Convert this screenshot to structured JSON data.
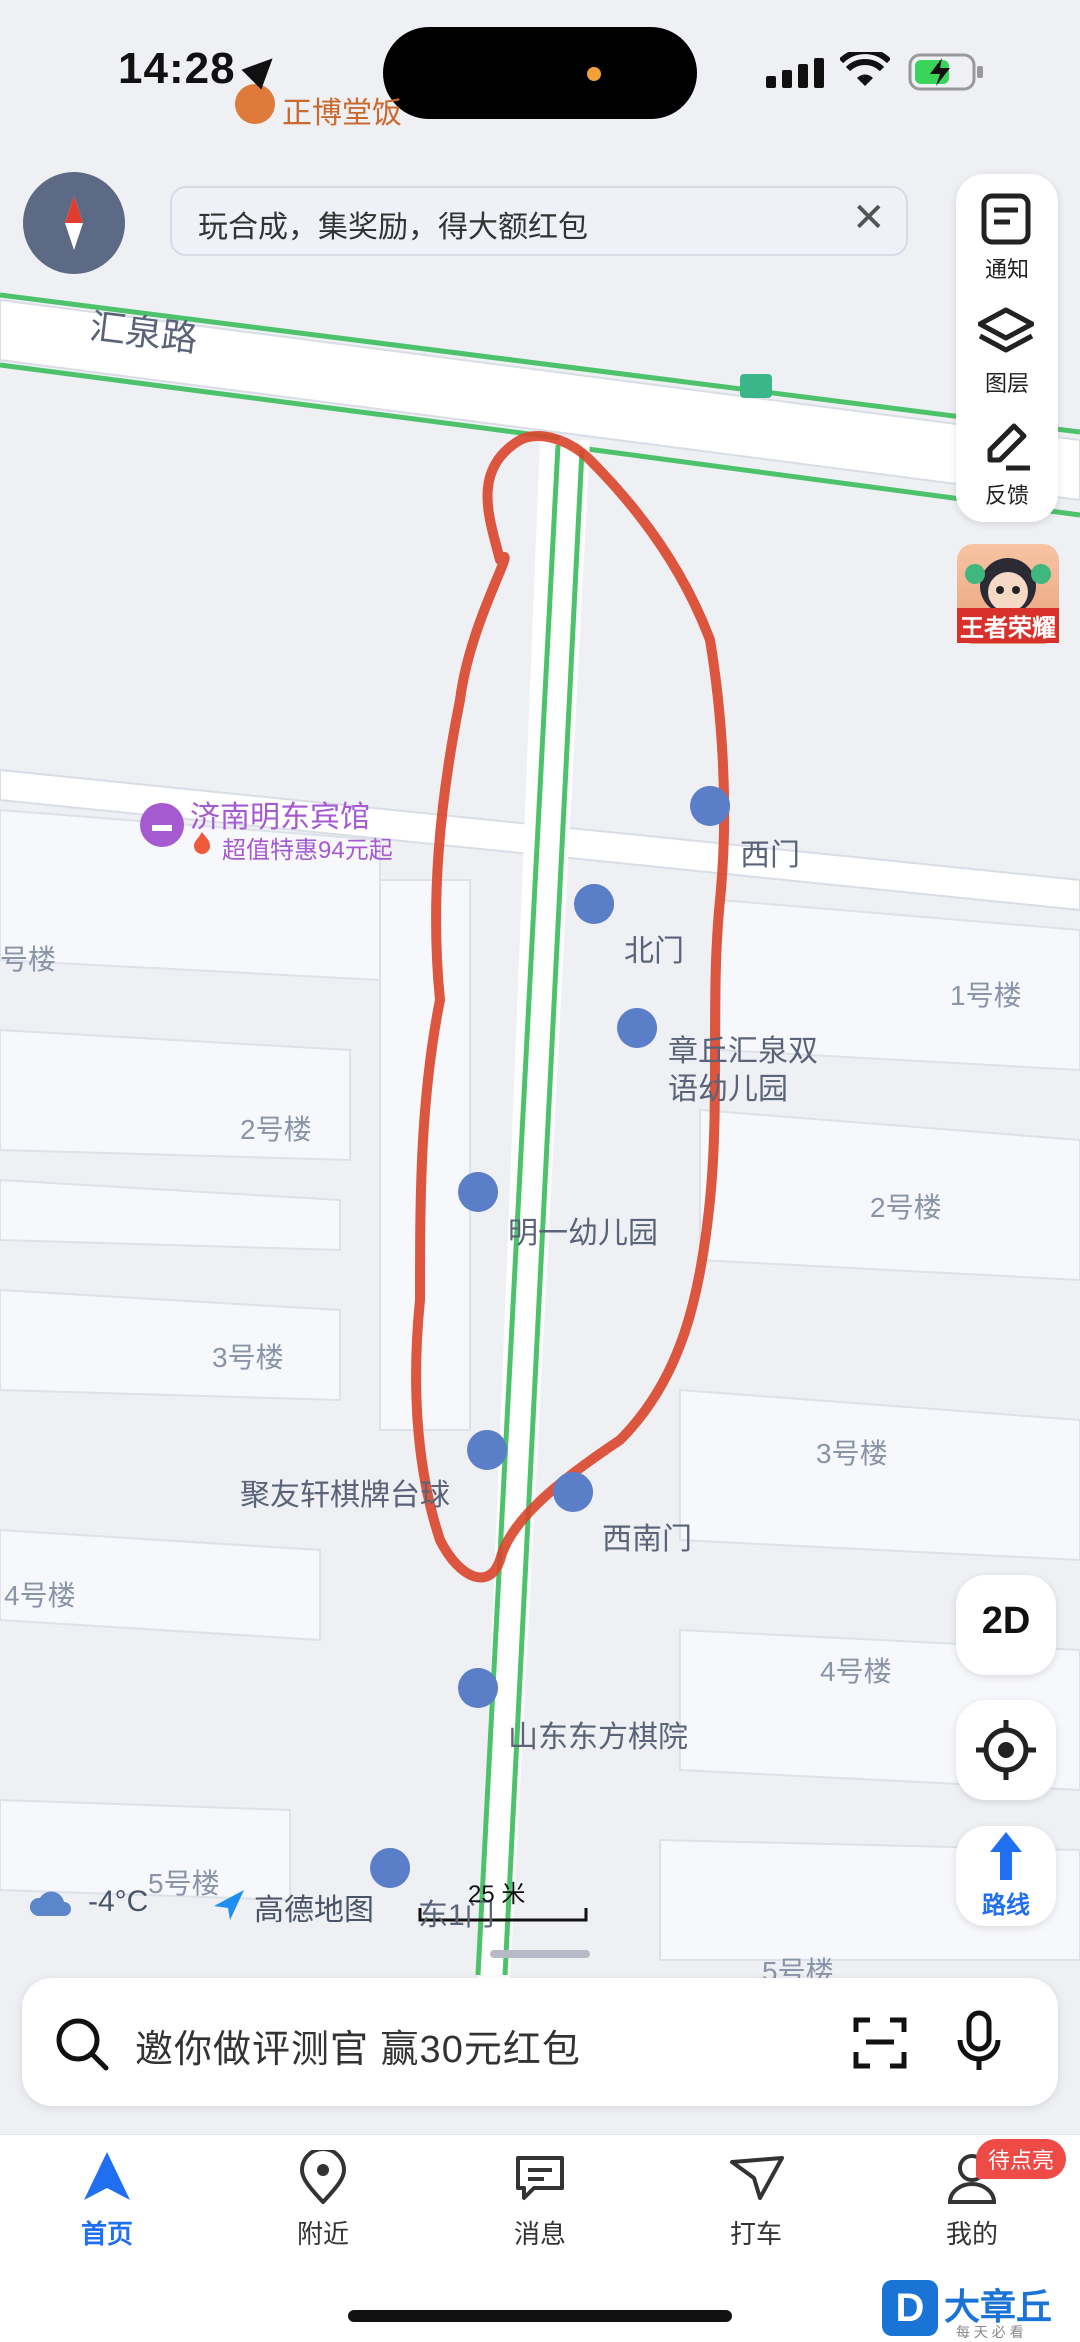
{
  "status_bar": {
    "time": "14:28"
  },
  "top_poi": {
    "label": "正博堂饭"
  },
  "banner": {
    "text": "玩合成，集奖励，得大额红包",
    "close": "✕"
  },
  "side_panel": {
    "items": [
      {
        "label": "通知",
        "icon": "notification-icon"
      },
      {
        "label": "图层",
        "icon": "layers-icon"
      },
      {
        "label": "反馈",
        "icon": "feedback-icon"
      }
    ]
  },
  "game_ad": {
    "label": "王者荣耀"
  },
  "map": {
    "road": "汇泉路",
    "hotel": {
      "name": "济南明东宾馆",
      "promo": "超值特惠94元起"
    },
    "pois": [
      "西门",
      "北门",
      "章丘汇泉双",
      "语幼儿园",
      "明一幼儿园",
      "聚友轩棋牌台球",
      "西南门",
      "山东东方棋院"
    ],
    "buildings": [
      "号楼",
      "1号楼",
      "2号楼",
      "2号楼",
      "3号楼",
      "3号楼",
      "4号楼",
      "4号楼",
      "5号楼",
      "5号楼"
    ],
    "east_gate": "东1门"
  },
  "controls": {
    "view_mode": "2D",
    "route_label": "路线"
  },
  "bottom_info": {
    "temperature": "-4°C",
    "brand": "高德地图",
    "scale": "25 米"
  },
  "search": {
    "placeholder": "邀你做评测官 赢30元红包"
  },
  "tabs": [
    {
      "label": "首页",
      "active": true
    },
    {
      "label": "附近",
      "active": false
    },
    {
      "label": "消息",
      "active": false
    },
    {
      "label": "打车",
      "active": false
    },
    {
      "label": "我的",
      "active": false
    }
  ],
  "tab_badge": "待点亮",
  "watermark": {
    "text": "大章丘",
    "sub": "每 天 必 看",
    "logo": "D"
  },
  "colors": {
    "accent": "#1f6ff0",
    "road_green": "#4cc36b",
    "annotation": "#d9452b",
    "badge": "#ef4b46"
  }
}
